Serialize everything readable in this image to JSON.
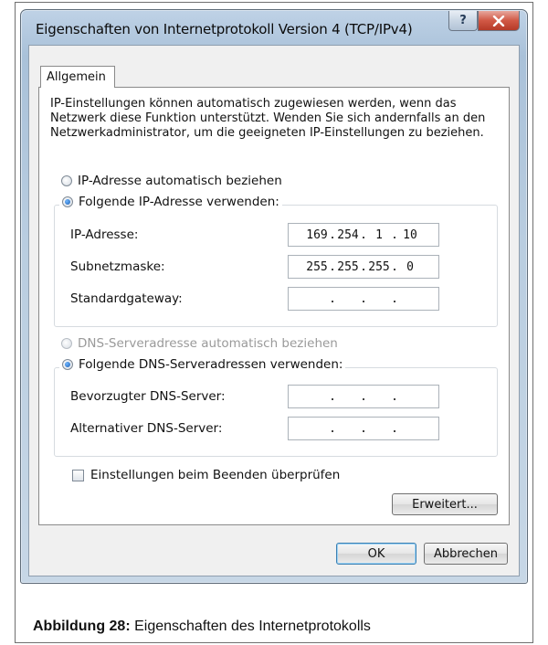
{
  "dialog": {
    "title": "Eigenschaften von Internetprotokoll Version 4 (TCP/IPv4)",
    "help_button": "?",
    "close_button": "X",
    "tab_label": "Allgemein",
    "description": "IP-Einstellungen können automatisch zugewiesen werden, wenn das Netzwerk diese Funktion unterstützt. Wenden Sie sich andernfalls an den Netzwerkadministrator, um die geeigneten IP-Einstellungen zu beziehen."
  },
  "ip_section": {
    "auto_radio": {
      "label": "IP-Adresse automatisch beziehen",
      "selected": false
    },
    "manual_radio": {
      "label": "Folgende IP-Adresse verwenden:",
      "selected": true
    },
    "fields": [
      {
        "label": "IP-Adresse:",
        "octets": [
          "169",
          "254",
          "1",
          "10"
        ]
      },
      {
        "label": "Subnetzmaske:",
        "octets": [
          "255",
          "255",
          "255",
          "0"
        ]
      },
      {
        "label": "Standardgateway:",
        "octets": [
          "",
          "",
          "",
          ""
        ]
      }
    ]
  },
  "dns_section": {
    "auto_radio": {
      "label": "DNS-Serveradresse automatisch beziehen",
      "selected": false,
      "disabled": true
    },
    "manual_radio": {
      "label": "Folgende DNS-Serveradressen verwenden:",
      "selected": true
    },
    "fields": [
      {
        "label": "Bevorzugter DNS-Server:",
        "octets": [
          "",
          "",
          "",
          ""
        ]
      },
      {
        "label": "Alternativer DNS-Server:",
        "octets": [
          "",
          "",
          "",
          ""
        ]
      }
    ]
  },
  "validate_checkbox": {
    "label": "Einstellungen beim Beenden überprüfen",
    "checked": false
  },
  "buttons": {
    "advanced": "Erweitert...",
    "ok": "OK",
    "cancel": "Abbrechen"
  },
  "caption": {
    "prefix": "Abbildung 28:",
    "text": " Eigenschaften des Internetprotokolls"
  },
  "icons": {
    "help": "question-icon",
    "close": "close-icon"
  }
}
